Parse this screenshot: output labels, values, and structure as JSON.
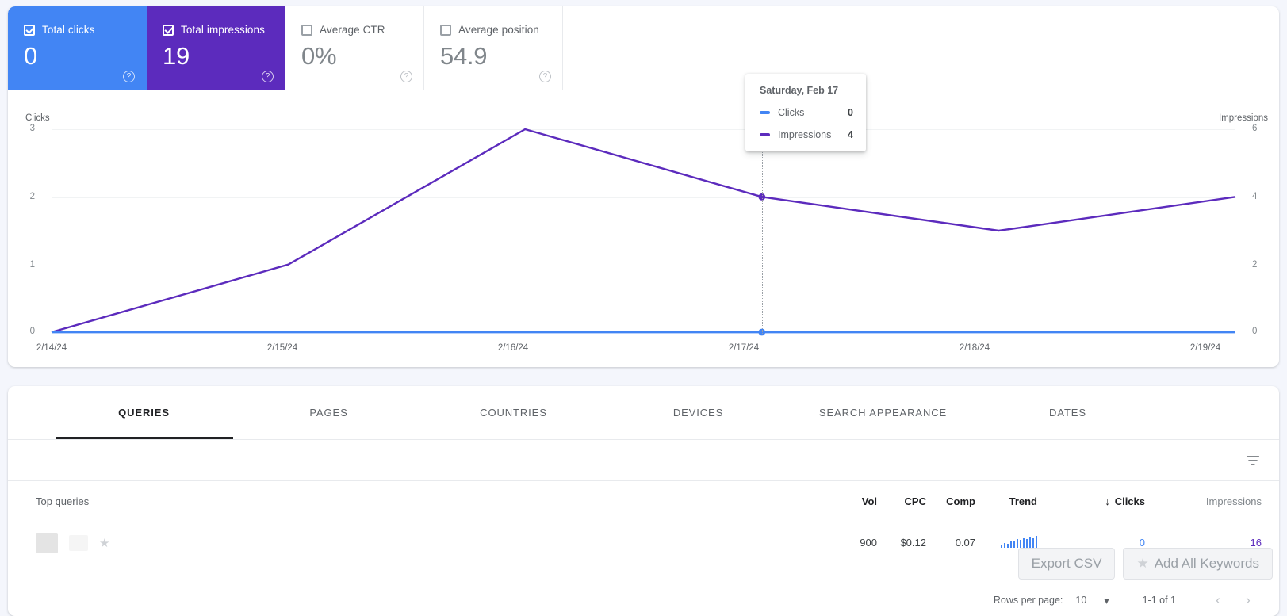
{
  "metrics": [
    {
      "label": "Total clicks",
      "value": "0",
      "checked": true,
      "state": "sel-blue"
    },
    {
      "label": "Total impressions",
      "value": "19",
      "checked": true,
      "state": "sel-purple"
    },
    {
      "label": "Average CTR",
      "value": "0%",
      "checked": false,
      "state": ""
    },
    {
      "label": "Average position",
      "value": "54.9",
      "checked": false,
      "state": ""
    }
  ],
  "colors": {
    "clicks": "#4285f4",
    "impressions": "#5c2bbd",
    "grid": "#f1f3f4"
  },
  "chart_data": {
    "type": "line",
    "title": "",
    "xlabel": "",
    "x": [
      "2/14/24",
      "2/15/24",
      "2/16/24",
      "2/17/24",
      "2/18/24",
      "2/19/24"
    ],
    "grid": true,
    "legend": "tooltip",
    "axes": {
      "left": {
        "label": "Clicks",
        "ticks": [
          "0",
          "1",
          "2",
          "3"
        ],
        "ylim": [
          0,
          3
        ]
      },
      "right": {
        "label": "Impressions",
        "ticks": [
          "0",
          "2",
          "4",
          "6"
        ],
        "ylim": [
          0,
          6
        ]
      }
    },
    "series": [
      {
        "name": "Clicks",
        "axis": "left",
        "color": "#4285f4",
        "values": [
          0,
          0,
          0,
          0,
          0,
          0
        ]
      },
      {
        "name": "Impressions",
        "axis": "right",
        "color": "#5c2bbd",
        "values": [
          0,
          2,
          6,
          4,
          3,
          4
        ]
      }
    ]
  },
  "tooltip": {
    "title": "Saturday, Feb 17",
    "rows": [
      {
        "name": "Clicks",
        "value": "0",
        "color": "#4285f4"
      },
      {
        "name": "Impressions",
        "value": "4",
        "color": "#5c2bbd"
      }
    ]
  },
  "tabs": [
    {
      "label": "QUERIES",
      "active": true
    },
    {
      "label": "PAGES",
      "active": false
    },
    {
      "label": "COUNTRIES",
      "active": false
    },
    {
      "label": "DEVICES",
      "active": false
    },
    {
      "label": "SEARCH APPEARANCE",
      "active": false
    },
    {
      "label": "DATES",
      "active": false
    }
  ],
  "table": {
    "headers": {
      "lead": "Top queries",
      "vol": "Vol",
      "cpc": "CPC",
      "comp": "Comp",
      "trend": "Trend",
      "clicks": "Clicks",
      "sort_arrow": "↓",
      "impressions": "Impressions"
    },
    "rows": [
      {
        "query": "",
        "vol": "900",
        "cpc": "$0.12",
        "comp": "0.07",
        "trend": [
          3,
          5,
          4,
          7,
          6,
          9,
          8,
          10,
          9,
          11,
          10,
          12
        ],
        "clicks": "0",
        "impressions": "16"
      }
    ]
  },
  "buttons": {
    "export_csv": "Export CSV",
    "add_all_keywords": "Add All Keywords",
    "star_icon": "★"
  },
  "pagination": {
    "rows_per_page_label": "Rows per page:",
    "rows_per_page_value": "10",
    "chevron": "▾",
    "range": "1-1 of 1",
    "prev": "‹",
    "next": "›"
  }
}
